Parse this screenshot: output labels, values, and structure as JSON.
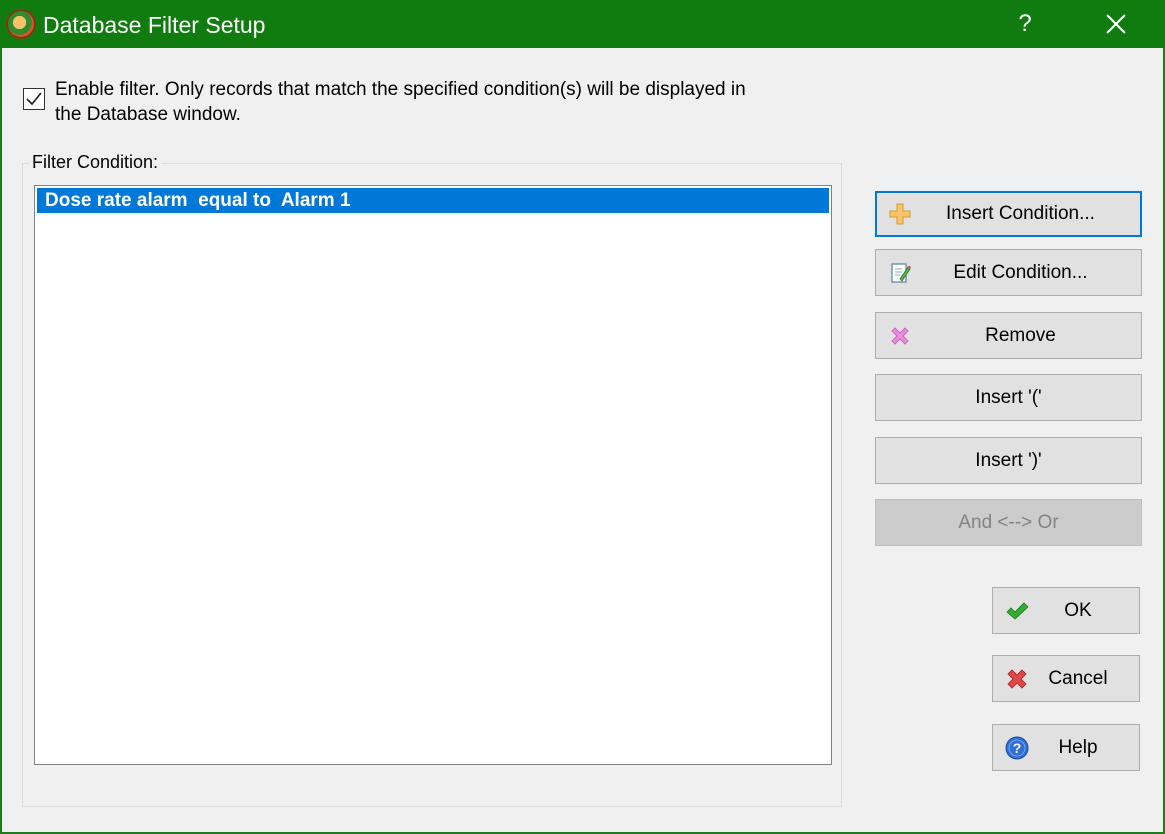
{
  "window": {
    "title": "Database Filter Setup",
    "help_glyph": "?",
    "close_icon": "close-icon"
  },
  "enable_filter": {
    "checked": true,
    "label": "Enable filter. Only records that match the specified condition(s) will be displayed in the Database window."
  },
  "filter_condition": {
    "label": "Filter Condition:",
    "items": [
      {
        "text": "Dose rate alarm  equal to  Alarm 1",
        "selected": true
      }
    ]
  },
  "actions": {
    "insert_condition": {
      "label": "Insert Condition...",
      "icon": "plus-icon"
    },
    "edit_condition": {
      "label": "Edit Condition...",
      "icon": "edit-icon"
    },
    "remove": {
      "label": "Remove",
      "icon": "remove-icon"
    },
    "insert_open": {
      "label": "Insert '('"
    },
    "insert_close": {
      "label": "Insert ')'"
    },
    "and_or": {
      "label": "And <--> Or",
      "disabled": true
    }
  },
  "dialog_buttons": {
    "ok": {
      "label": "OK",
      "icon": "checkmark-icon"
    },
    "cancel": {
      "label": "Cancel",
      "icon": "x-icon"
    },
    "help": {
      "label": "Help",
      "icon": "question-icon"
    }
  },
  "colors": {
    "titlebar": "#107c10",
    "selection": "#0078d7",
    "button_face": "#e1e1e1"
  }
}
